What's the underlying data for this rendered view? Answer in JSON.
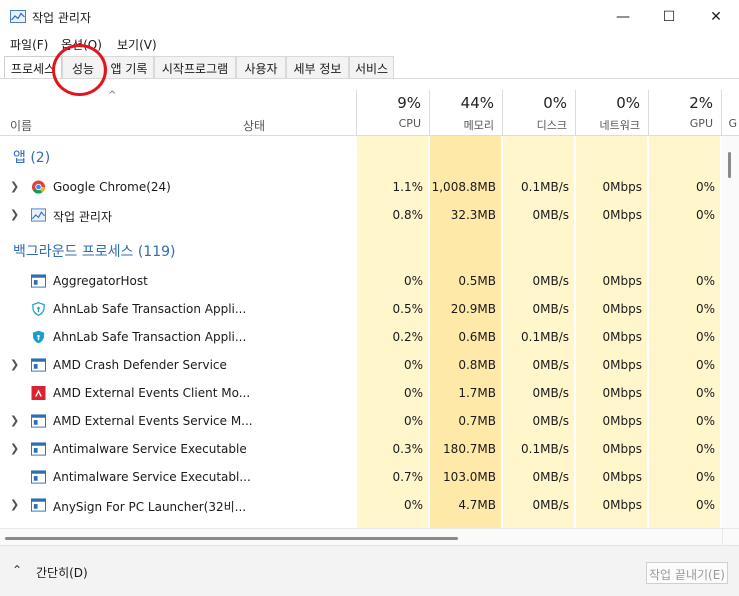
{
  "window": {
    "title": "작업 관리자",
    "minimize": "—",
    "maximize": "☐",
    "close": "✕"
  },
  "menu": [
    "파일(F)",
    "옵션(O)",
    "보기(V)"
  ],
  "tabs": [
    "프로세스",
    "성능",
    "앱 기록",
    "시작프로그램",
    "사용자",
    "세부 정보",
    "서비스"
  ],
  "header": {
    "sort_arrow": "^",
    "name": "이름",
    "status": "상태",
    "columns": [
      {
        "pct": "9%",
        "label": "CPU"
      },
      {
        "pct": "44%",
        "label": "메모리"
      },
      {
        "pct": "0%",
        "label": "디스크"
      },
      {
        "pct": "0%",
        "label": "네트워크"
      },
      {
        "pct": "2%",
        "label": "GPU"
      },
      {
        "pct": "",
        "label": "G"
      }
    ]
  },
  "groups": {
    "apps": "앱 (2)",
    "background": "백그라운드 프로세스 (119)"
  },
  "apps": [
    {
      "name": "Google Chrome(24)",
      "cpu": "1.1%",
      "mem": "1,008.8MB",
      "disk": "0.1MB/s",
      "net": "0Mbps",
      "gpu": "0%"
    },
    {
      "name": "작업 관리자",
      "cpu": "0.8%",
      "mem": "32.3MB",
      "disk": "0MB/s",
      "net": "0Mbps",
      "gpu": "0%"
    }
  ],
  "background": [
    {
      "name": "AggregatorHost",
      "cpu": "0%",
      "mem": "0.5MB",
      "disk": "0MB/s",
      "net": "0Mbps",
      "gpu": "0%"
    },
    {
      "name": "AhnLab Safe Transaction Appli...",
      "cpu": "0.5%",
      "mem": "20.9MB",
      "disk": "0MB/s",
      "net": "0Mbps",
      "gpu": "0%"
    },
    {
      "name": "AhnLab Safe Transaction Appli...",
      "cpu": "0.2%",
      "mem": "0.6MB",
      "disk": "0.1MB/s",
      "net": "0Mbps",
      "gpu": "0%"
    },
    {
      "name": "AMD Crash Defender Service",
      "cpu": "0%",
      "mem": "0.8MB",
      "disk": "0MB/s",
      "net": "0Mbps",
      "gpu": "0%"
    },
    {
      "name": "AMD External Events Client Mo...",
      "cpu": "0%",
      "mem": "1.7MB",
      "disk": "0MB/s",
      "net": "0Mbps",
      "gpu": "0%"
    },
    {
      "name": "AMD External Events Service M...",
      "cpu": "0%",
      "mem": "0.7MB",
      "disk": "0MB/s",
      "net": "0Mbps",
      "gpu": "0%"
    },
    {
      "name": "Antimalware Service Executable",
      "cpu": "0.3%",
      "mem": "180.7MB",
      "disk": "0.1MB/s",
      "net": "0Mbps",
      "gpu": "0%"
    },
    {
      "name": "Antimalware Service Executabl...",
      "cpu": "0.7%",
      "mem": "103.0MB",
      "disk": "0MB/s",
      "net": "0Mbps",
      "gpu": "0%"
    },
    {
      "name": "AnySign For PC Launcher(32비...",
      "cpu": "0%",
      "mem": "4.7MB",
      "disk": "0MB/s",
      "net": "0Mbps",
      "gpu": "0%"
    }
  ],
  "footer": {
    "collapse": "간단히(D)",
    "end_task": "작업 끝내기(E)"
  },
  "colors": {
    "group_blue": "#2f6db5",
    "cell_yellow": "#fff6cc",
    "cell_yellow_hi": "#ffe9a8",
    "annotation_red": "#e3141b"
  }
}
